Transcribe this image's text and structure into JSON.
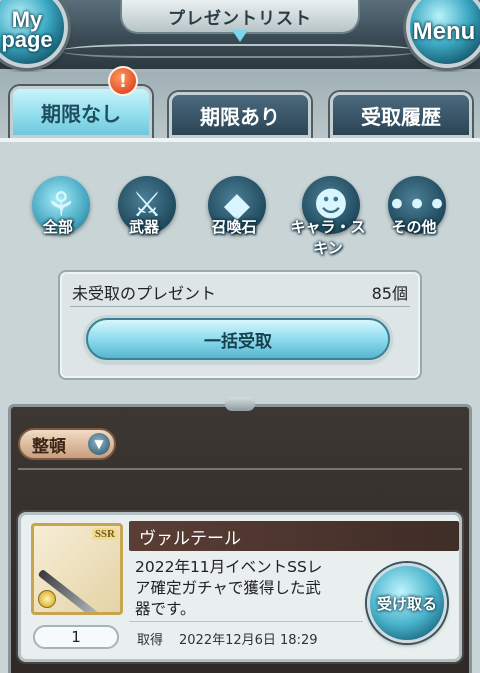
{
  "header": {
    "title": "プレゼントリスト",
    "mypage_label_line1": "My",
    "mypage_label_line2": "page",
    "menu_label": "Menu"
  },
  "tabs": [
    {
      "label": "期限なし",
      "active": true,
      "alert": "!"
    },
    {
      "label": "期限あり",
      "active": false
    },
    {
      "label": "受取履歴",
      "active": false
    }
  ],
  "filters": [
    {
      "label": "全部",
      "icon": "all-items-icon",
      "selected": true
    },
    {
      "label": "武器",
      "icon": "sword-icon",
      "selected": false
    },
    {
      "label": "召喚石",
      "icon": "crystal-icon",
      "selected": false
    },
    {
      "label": "キャラ・スキン",
      "icon": "character-icon",
      "selected": false
    },
    {
      "label": "その他",
      "icon": "ellipsis-icon",
      "selected": false
    }
  ],
  "summary": {
    "label": "未受取のプレゼント",
    "count": "85個",
    "bulk_button": "一括受取"
  },
  "list": {
    "sort_label": "整頓"
  },
  "items": [
    {
      "name": "ヴァルテール",
      "rarity": "SSR",
      "desc_line1": "2022年11月イベントSSレ",
      "desc_line2": "ア確定ガチャで獲得した武",
      "desc_line3": "器です。",
      "receive_button": "受け取る",
      "quantity": "1",
      "acquired_label": "取得",
      "acquired_date": "2022年12月6日 18:29"
    }
  ],
  "colors": {
    "accent": "#8fdcec",
    "header_dark": "#3b4b55",
    "panel_dark": "#2e2926"
  }
}
